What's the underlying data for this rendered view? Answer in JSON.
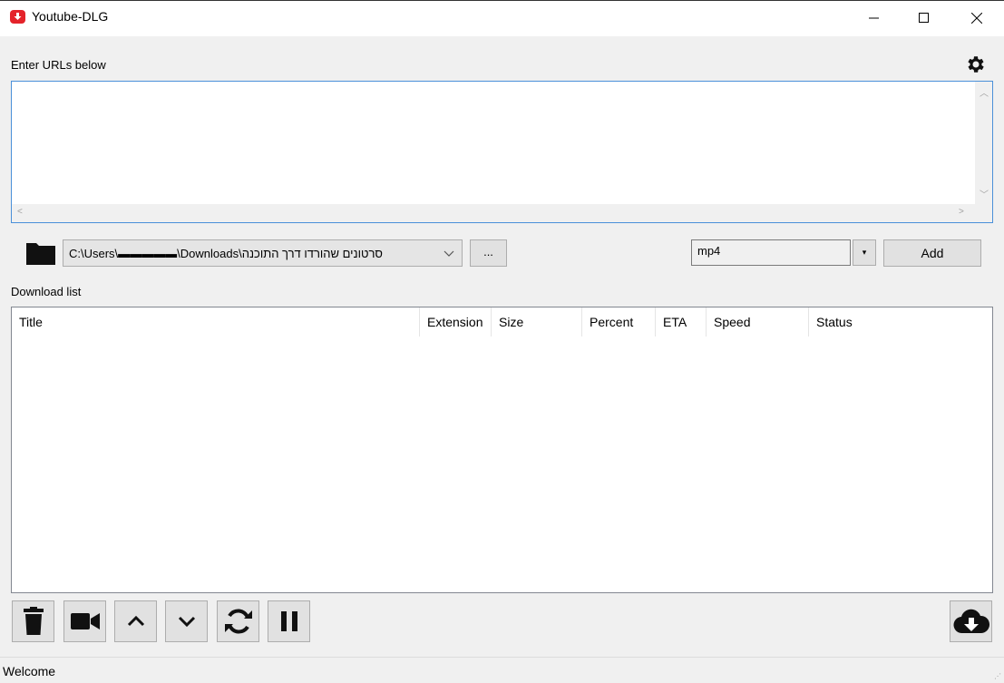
{
  "window": {
    "title": "Youtube-DLG",
    "icons": {
      "app": "youtube-dlg-app-icon",
      "minimize": "minimize-icon",
      "maximize": "maximize-icon",
      "close": "close-icon"
    }
  },
  "urls": {
    "label": "Enter URLs below",
    "value": "",
    "settings_icon": "gear-icon"
  },
  "download_path": {
    "folder_icon": "folder-icon",
    "value": "C:\\Users\\▬▬▬▬▬\\Downloads\\סרטונים שהורדו דרך התוכנה",
    "browse_label": "..."
  },
  "format": {
    "value": "mp4",
    "dropdown_glyph": "▾"
  },
  "add_button": {
    "label": "Add"
  },
  "download_list": {
    "label": "Download list",
    "columns": [
      "Title",
      "Extension",
      "Size",
      "Percent",
      "ETA",
      "Speed",
      "Status"
    ],
    "rows": []
  },
  "toolbar": {
    "buttons": [
      "trash-icon",
      "video-camera-icon",
      "chevron-up-icon",
      "chevron-down-icon",
      "sync-icon",
      "pause-icon"
    ],
    "download_icon": "cloud-download-icon"
  },
  "status_bar": {
    "text": "Welcome"
  },
  "colors": {
    "accent": "#4a90d9",
    "app_icon": "#e4232a",
    "redaction": "#e8201c"
  }
}
